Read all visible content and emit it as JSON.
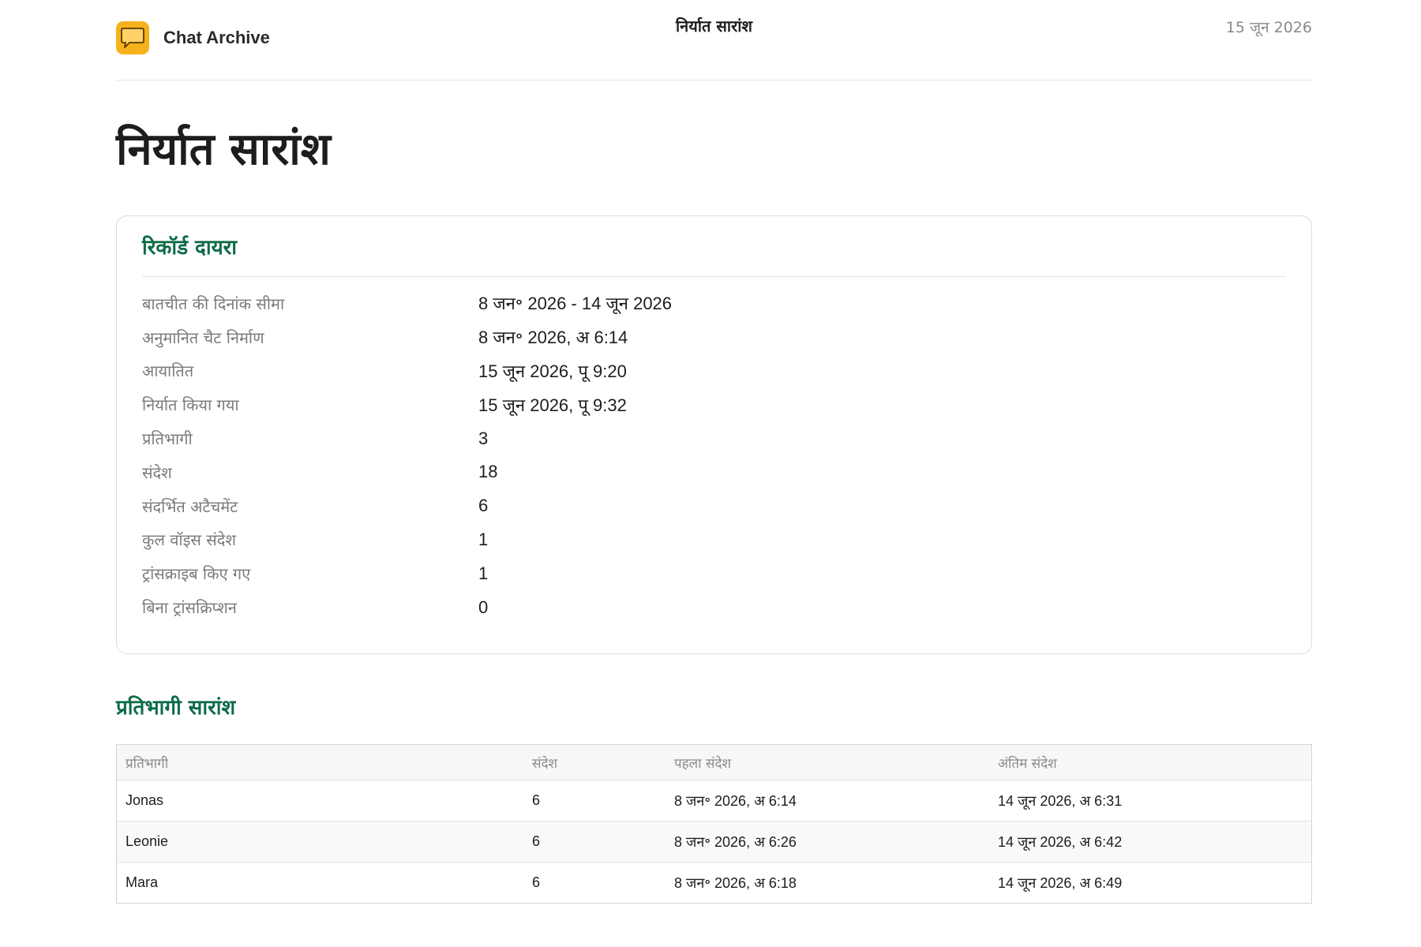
{
  "header": {
    "app_name": "Chat Archive",
    "title": "निर्यात सारांश",
    "date": "15 जून 2026",
    "icon": "chat-bubble-icon",
    "accent_color": "#f6b21b"
  },
  "page": {
    "title": "निर्यात सारांश"
  },
  "record_scope": {
    "title": "रिकॉर्ड दायरा",
    "rows": [
      {
        "label": "बातचीत की दिनांक सीमा",
        "value": "8 जन॰ 2026 - 14 जून 2026"
      },
      {
        "label": "अनुमानित चैट निर्माण",
        "value": "8 जन॰ 2026, अ 6:14"
      },
      {
        "label": "आयातित",
        "value": "15 जून 2026, पू 9:20"
      },
      {
        "label": "निर्यात किया गया",
        "value": "15 जून 2026, पू 9:32"
      },
      {
        "label": "प्रतिभागी",
        "value": "3"
      },
      {
        "label": "संदेश",
        "value": "18"
      },
      {
        "label": "संदर्भित अटैचमेंट",
        "value": "6"
      },
      {
        "label": "कुल वॉइस संदेश",
        "value": "1"
      },
      {
        "label": "ट्रांसक्राइब किए गए",
        "value": "1"
      },
      {
        "label": "बिना ट्रांसक्रिप्शन",
        "value": "0"
      }
    ]
  },
  "participants": {
    "title": "प्रतिभागी सारांश",
    "columns": [
      "प्रतिभागी",
      "संदेश",
      "पहला संदेश",
      "अंतिम संदेश"
    ],
    "rows": [
      [
        "Jonas",
        "6",
        "8 जन॰ 2026, अ 6:14",
        "14 जून 2026, अ 6:31"
      ],
      [
        "Leonie",
        "6",
        "8 जन॰ 2026, अ 6:26",
        "14 जून 2026, अ 6:42"
      ],
      [
        "Mara",
        "6",
        "8 जन॰ 2026, अ 6:18",
        "14 जून 2026, अ 6:49"
      ]
    ]
  },
  "colors": {
    "section_title": "#0e6b47"
  }
}
